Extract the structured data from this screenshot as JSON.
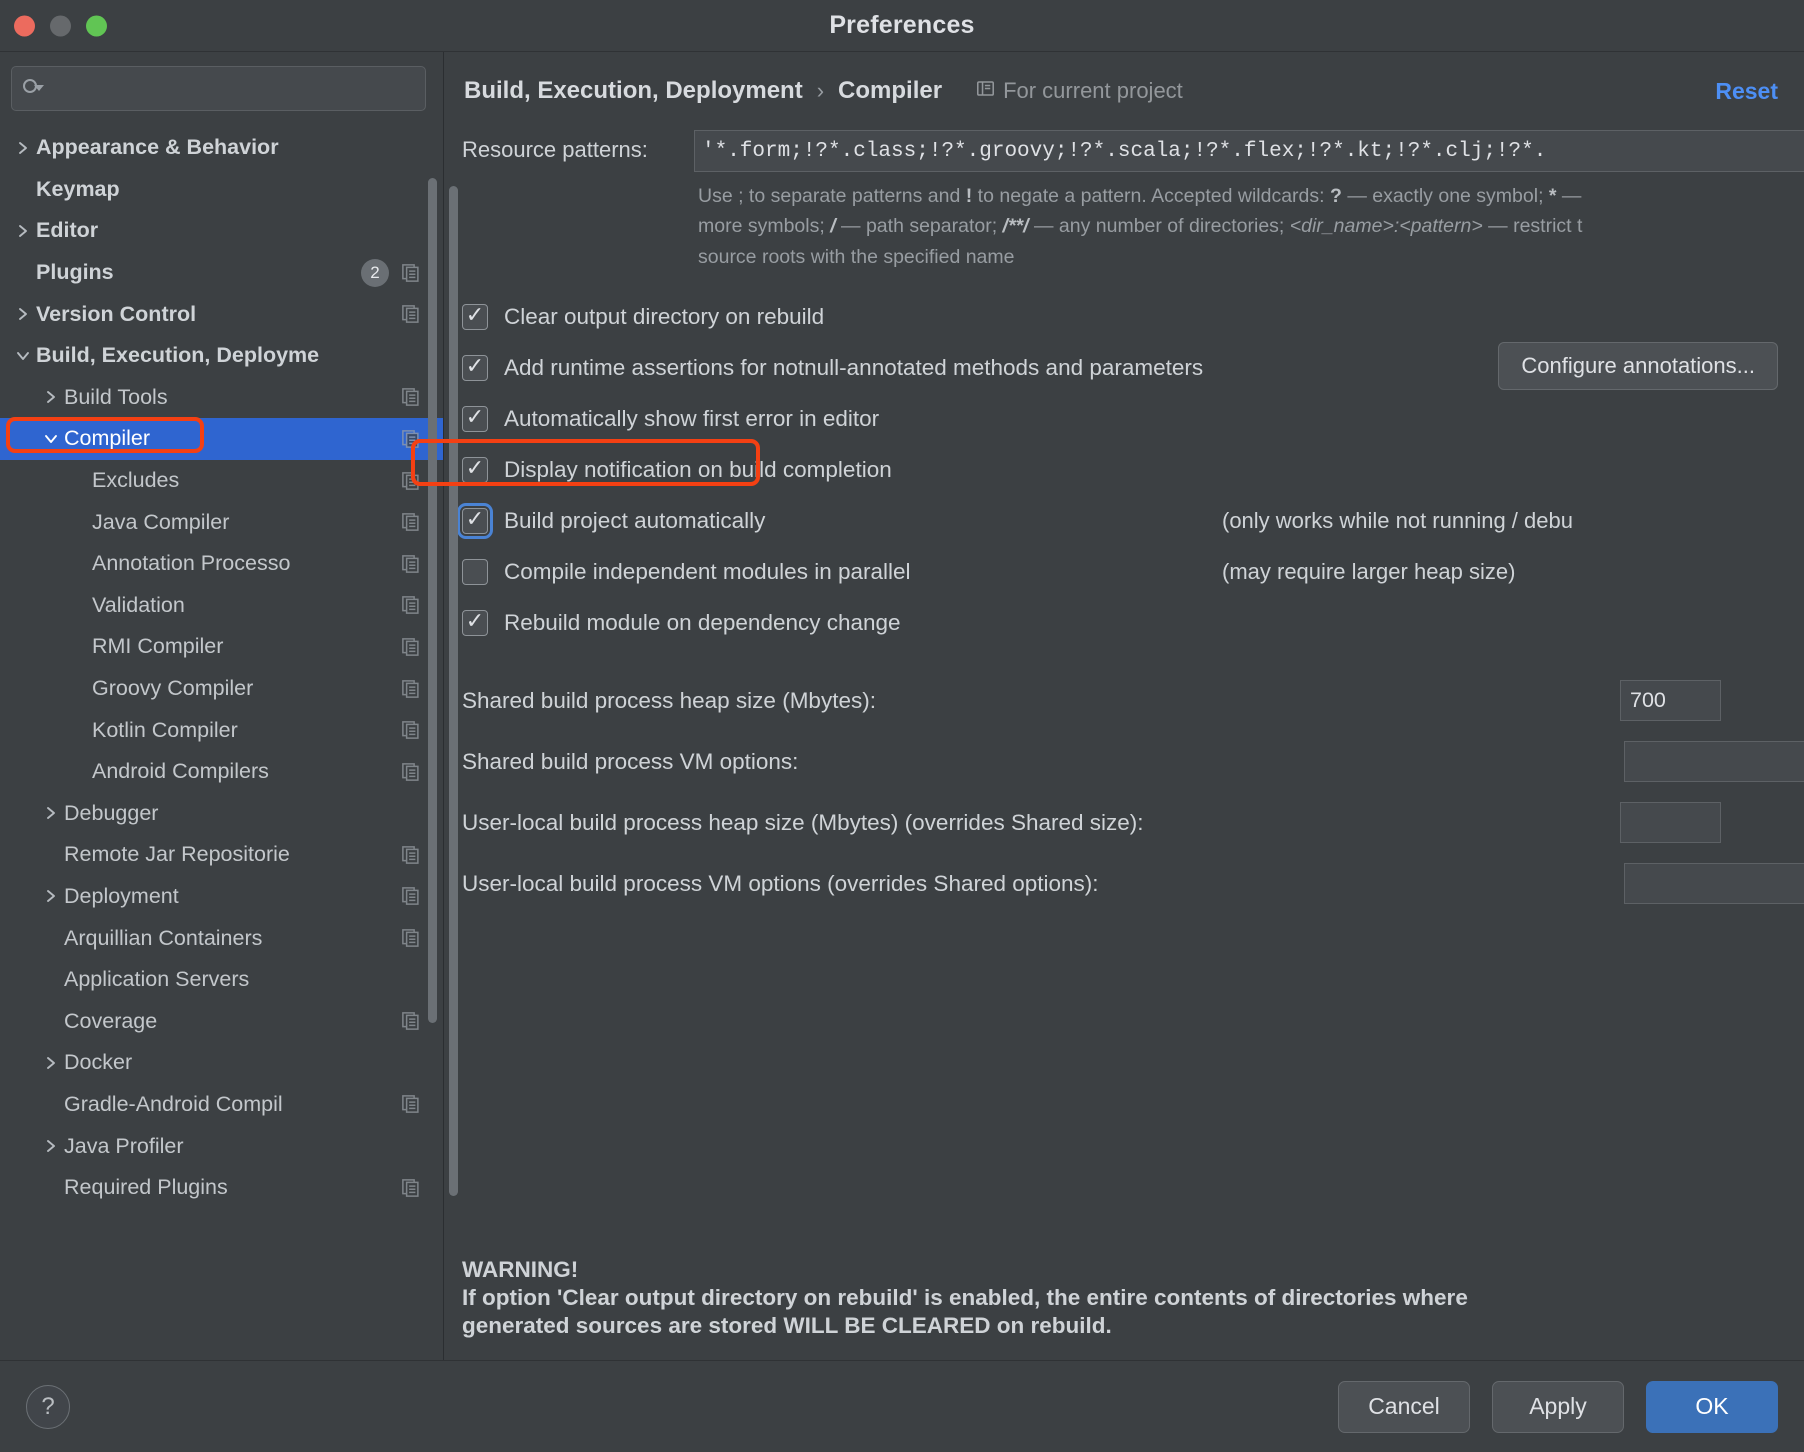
{
  "window": {
    "title": "Preferences",
    "traffic_lights": [
      "close",
      "minimize",
      "zoom"
    ]
  },
  "search": {
    "value": "",
    "placeholder": ""
  },
  "sidebar": {
    "items": [
      {
        "label": "Appearance & Behavior",
        "indent": 0,
        "twisty": "right",
        "bold": true,
        "copy": false,
        "badge": null,
        "selected": false
      },
      {
        "label": "Keymap",
        "indent": 0,
        "twisty": "none",
        "bold": true,
        "copy": false,
        "badge": null,
        "selected": false
      },
      {
        "label": "Editor",
        "indent": 0,
        "twisty": "right",
        "bold": true,
        "copy": false,
        "badge": null,
        "selected": false
      },
      {
        "label": "Plugins",
        "indent": 0,
        "twisty": "none",
        "bold": true,
        "copy": true,
        "badge": "2",
        "selected": false
      },
      {
        "label": "Version Control",
        "indent": 0,
        "twisty": "right",
        "bold": true,
        "copy": true,
        "badge": null,
        "selected": false
      },
      {
        "label": "Build, Execution, Deploymе",
        "indent": 0,
        "twisty": "down",
        "bold": true,
        "copy": false,
        "badge": null,
        "selected": false
      },
      {
        "label": "Build Tools",
        "indent": 1,
        "twisty": "right",
        "bold": false,
        "copy": true,
        "badge": null,
        "selected": false
      },
      {
        "label": "Compiler",
        "indent": 1,
        "twisty": "down",
        "bold": false,
        "copy": true,
        "badge": null,
        "selected": true
      },
      {
        "label": "Excludes",
        "indent": 2,
        "twisty": "none",
        "bold": false,
        "copy": true,
        "badge": null,
        "selected": false
      },
      {
        "label": "Java Compiler",
        "indent": 2,
        "twisty": "none",
        "bold": false,
        "copy": true,
        "badge": null,
        "selected": false
      },
      {
        "label": "Annotation Processo",
        "indent": 2,
        "twisty": "none",
        "bold": false,
        "copy": true,
        "badge": null,
        "selected": false
      },
      {
        "label": "Validation",
        "indent": 2,
        "twisty": "none",
        "bold": false,
        "copy": true,
        "badge": null,
        "selected": false
      },
      {
        "label": "RMI Compiler",
        "indent": 2,
        "twisty": "none",
        "bold": false,
        "copy": true,
        "badge": null,
        "selected": false
      },
      {
        "label": "Groovy Compiler",
        "indent": 2,
        "twisty": "none",
        "bold": false,
        "copy": true,
        "badge": null,
        "selected": false
      },
      {
        "label": "Kotlin Compiler",
        "indent": 2,
        "twisty": "none",
        "bold": false,
        "copy": true,
        "badge": null,
        "selected": false
      },
      {
        "label": "Android Compilers",
        "indent": 2,
        "twisty": "none",
        "bold": false,
        "copy": true,
        "badge": null,
        "selected": false
      },
      {
        "label": "Debugger",
        "indent": 1,
        "twisty": "right",
        "bold": false,
        "copy": false,
        "badge": null,
        "selected": false
      },
      {
        "label": "Remote Jar Repositorie",
        "indent": 1,
        "twisty": "none",
        "bold": false,
        "copy": true,
        "badge": null,
        "selected": false
      },
      {
        "label": "Deployment",
        "indent": 1,
        "twisty": "right",
        "bold": false,
        "copy": true,
        "badge": null,
        "selected": false
      },
      {
        "label": "Arquillian Containers",
        "indent": 1,
        "twisty": "none",
        "bold": false,
        "copy": true,
        "badge": null,
        "selected": false
      },
      {
        "label": "Application Servers",
        "indent": 1,
        "twisty": "none",
        "bold": false,
        "copy": false,
        "badge": null,
        "selected": false
      },
      {
        "label": "Coverage",
        "indent": 1,
        "twisty": "none",
        "bold": false,
        "copy": true,
        "badge": null,
        "selected": false
      },
      {
        "label": "Docker",
        "indent": 1,
        "twisty": "right",
        "bold": false,
        "copy": false,
        "badge": null,
        "selected": false
      },
      {
        "label": "Gradle-Android Compil",
        "indent": 1,
        "twisty": "none",
        "bold": false,
        "copy": true,
        "badge": null,
        "selected": false
      },
      {
        "label": "Java Profiler",
        "indent": 1,
        "twisty": "right",
        "bold": false,
        "copy": false,
        "badge": null,
        "selected": false
      },
      {
        "label": "Required Plugins",
        "indent": 1,
        "twisty": "none",
        "bold": false,
        "copy": true,
        "badge": null,
        "selected": false
      }
    ]
  },
  "header": {
    "breadcrumb_parent": "Build, Execution, Deployment",
    "breadcrumb_sep": "›",
    "breadcrumb_current": "Compiler",
    "project_scope": "For current project",
    "reset_label": "Reset"
  },
  "main": {
    "resource_patterns_label": "Resource patterns:",
    "resource_patterns_value": "'*.form;!?*.class;!?*.groovy;!?*.scala;!?*.flex;!?*.kt;!?*.clj;!?*.",
    "hint_line1_a": "Use ; to separate patterns and ",
    "hint_line1_bang": "!",
    "hint_line1_b": " to negate a pattern. Accepted wildcards: ",
    "hint_line1_q": "?",
    "hint_line1_c": " — exactly one symbol; ",
    "hint_line1_star": "*",
    "hint_line1_d": " —",
    "hint_line2_a": "more symbols; ",
    "hint_line2_slash": "/",
    "hint_line2_b": " — path separator; ",
    "hint_line2_glob": "/**/",
    "hint_line2_c": " — any number of directories; ",
    "hint_line2_dir": "<dir_name>:<pattern>",
    "hint_line2_d": " — restrict t",
    "hint_line3": "source roots with the specified name",
    "checkboxes": [
      {
        "label": "Clear output directory on rebuild",
        "checked": true,
        "focused": false,
        "note": ""
      },
      {
        "label": "Add runtime assertions for notnull-annotated methods and parameters",
        "checked": true,
        "focused": false,
        "note": ""
      },
      {
        "label": "Automatically show first error in editor",
        "checked": true,
        "focused": false,
        "note": ""
      },
      {
        "label": "Display notification on build completion",
        "checked": true,
        "focused": false,
        "note": ""
      },
      {
        "label": "Build project automatically",
        "checked": true,
        "focused": true,
        "note": "(only works while not running / debu"
      },
      {
        "label": "Compile independent modules in parallel",
        "checked": false,
        "focused": false,
        "note": "(may require larger heap size)"
      },
      {
        "label": "Rebuild module on dependency change",
        "checked": true,
        "focused": false,
        "note": ""
      }
    ],
    "configure_annotations_label": "Configure annotations...",
    "fields": [
      {
        "label": "Shared build process heap size (Mbytes):",
        "value": "700",
        "size": "small"
      },
      {
        "label": "Shared build process VM options:",
        "value": "",
        "size": "wide"
      },
      {
        "label": "User-local build process heap size (Mbytes) (overrides Shared size):",
        "value": "",
        "size": "small"
      },
      {
        "label": "User-local build process VM options (overrides Shared options):",
        "value": "",
        "size": "wide"
      }
    ],
    "warning_title": "WARNING!",
    "warning_line1": "If option 'Clear output directory on rebuild' is enabled, the entire contents of directories where",
    "warning_line2": "generated sources are stored WILL BE CLEARED on rebuild."
  },
  "footer": {
    "help_label": "?",
    "cancel_label": "Cancel",
    "apply_label": "Apply",
    "ok_label": "OK"
  },
  "colors": {
    "accent_blue": "#2f65d0",
    "link_blue": "#4d8ff5",
    "primary_button": "#3b71b8",
    "highlight_red": "#f44013",
    "focus_ring": "#4a83d4"
  }
}
